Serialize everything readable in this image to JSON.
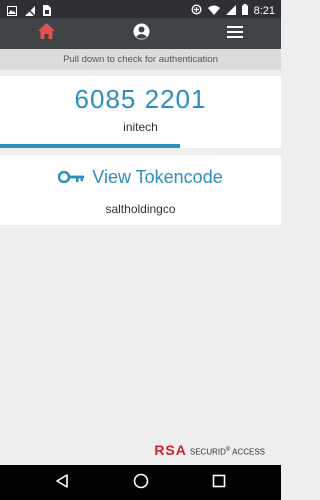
{
  "status_bar": {
    "time": "8:21",
    "left_icons": [
      "image-icon",
      "no-signal-icon",
      "sim-icon"
    ],
    "right_icons": [
      "data-saver-icon",
      "wifi-icon",
      "signal-icon",
      "battery-icon"
    ]
  },
  "header": {
    "tabs": [
      "home-icon",
      "account-icon",
      "menu-icon"
    ],
    "active_tab": "home-icon",
    "active_color": "#e0524f"
  },
  "banner": {
    "text": "Pull down to check for authentication"
  },
  "otp_card": {
    "code": "6085 2201",
    "account": "initech",
    "progress_fraction": 0.64,
    "accent": "#2a8fbd"
  },
  "token_card": {
    "link_label": "View Tokencode",
    "account": "saltholdingco",
    "icon": "key-icon"
  },
  "branding": {
    "rsa": "RSA",
    "product": "SECURID",
    "mark": "®",
    "access": "ACCESS"
  },
  "system_nav": [
    "back-icon",
    "home-circle-icon",
    "recents-icon"
  ]
}
